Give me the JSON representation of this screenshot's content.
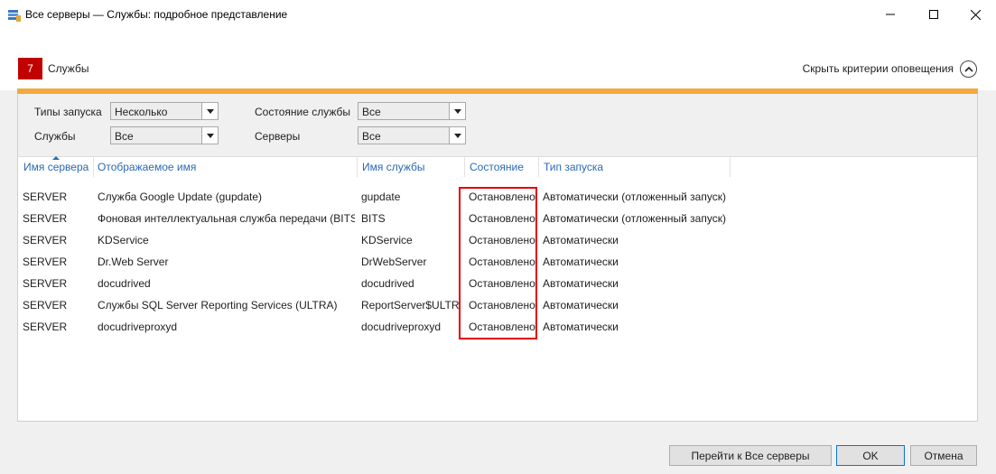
{
  "window": {
    "title": "Все серверы — Службы: подробное представление",
    "minimize_icon": "minimize-icon",
    "maximize_icon": "maximize-icon",
    "close_icon": "close-icon"
  },
  "header": {
    "count": "7",
    "title": "Службы",
    "hide_criteria_label": "Скрыть критерии оповещения",
    "accent_color": "#c10000",
    "bar_color": "#f4a93c"
  },
  "filters": {
    "startup_types_label": "Типы запуска",
    "startup_types_value": "Несколько",
    "services_label": "Службы",
    "services_value": "Все",
    "service_state_label": "Состояние службы",
    "service_state_value": "Все",
    "servers_label": "Серверы",
    "servers_value": "Все"
  },
  "table": {
    "columns": [
      "Имя сервера",
      "Отображаемое имя",
      "Имя службы",
      "Состояние",
      "Тип запуска"
    ],
    "sorted_column": "Имя сервера",
    "rows": [
      [
        "SERVER",
        "Служба Google Update (gupdate)",
        "gupdate",
        "Остановлено",
        "Автоматически (отложенный запуск)"
      ],
      [
        "SERVER",
        "Фоновая интеллектуальная служба передачи (BITS)",
        "BITS",
        "Остановлено",
        "Автоматически (отложенный запуск)"
      ],
      [
        "SERVER",
        "KDService",
        "KDService",
        "Остановлено",
        "Автоматически"
      ],
      [
        "SERVER",
        "Dr.Web Server",
        "DrWebServer",
        "Остановлено",
        "Автоматически"
      ],
      [
        "SERVER",
        "docudrived",
        "docudrived",
        "Остановлено",
        "Автоматически"
      ],
      [
        "SERVER",
        "Службы SQL Server Reporting Services (ULTRA)",
        "ReportServer$ULTRA",
        "Остановлено",
        "Автоматически"
      ],
      [
        "SERVER",
        "docudriveproxyd",
        "docudriveproxyd",
        "Остановлено",
        "Автоматически"
      ]
    ]
  },
  "footer": {
    "goto_all_servers": "Перейти к Все серверы",
    "ok": "OK",
    "cancel": "Отмена"
  }
}
